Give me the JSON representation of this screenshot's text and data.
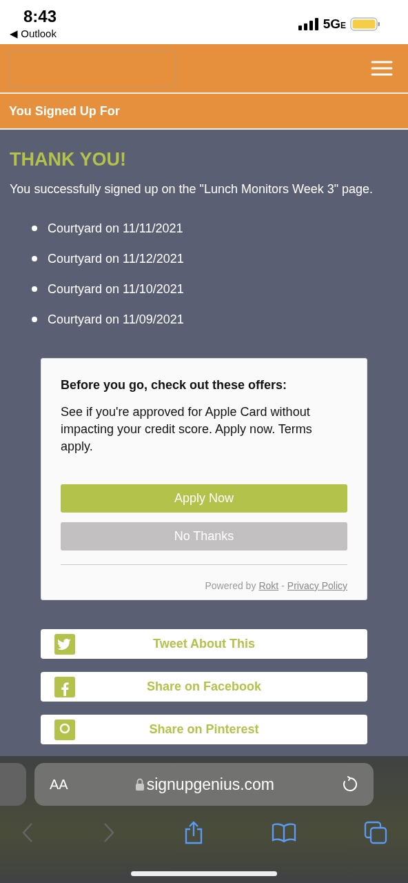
{
  "status_bar": {
    "time": "8:43",
    "back_app": "◀ Outlook",
    "network": "5G",
    "network_suffix": "E"
  },
  "header": {
    "section_title": "You Signed Up For"
  },
  "confirmation": {
    "heading": "THANK YOU!",
    "message": "You successfully signed up on the \"Lunch Monitors Week 3\" page.",
    "items": [
      "Courtyard on 11/11/2021",
      "Courtyard on 11/12/2021",
      "Courtyard on 11/10/2021",
      "Courtyard on 11/09/2021"
    ]
  },
  "offer": {
    "title": "Before you go, check out these offers:",
    "text": "See if you're approved for Apple Card without impacting your credit score. Apply now. Terms apply.",
    "buttons": [
      {
        "label": "Apply Now",
        "kind": "primary"
      },
      {
        "label": "No Thanks",
        "kind": "secondary"
      }
    ],
    "powered_by": "Powered by",
    "provider_link": "Rokt",
    "separator": "-",
    "privacy_link": "Privacy Policy"
  },
  "share_buttons": [
    {
      "label": "Tweet About This",
      "kind": "twitter"
    },
    {
      "label": "Share on Facebook",
      "kind": "facebook"
    },
    {
      "label": "Share on Pinterest",
      "kind": "pinterest"
    }
  ],
  "browser": {
    "text_size": "AA",
    "url": "signupgenius.com"
  }
}
